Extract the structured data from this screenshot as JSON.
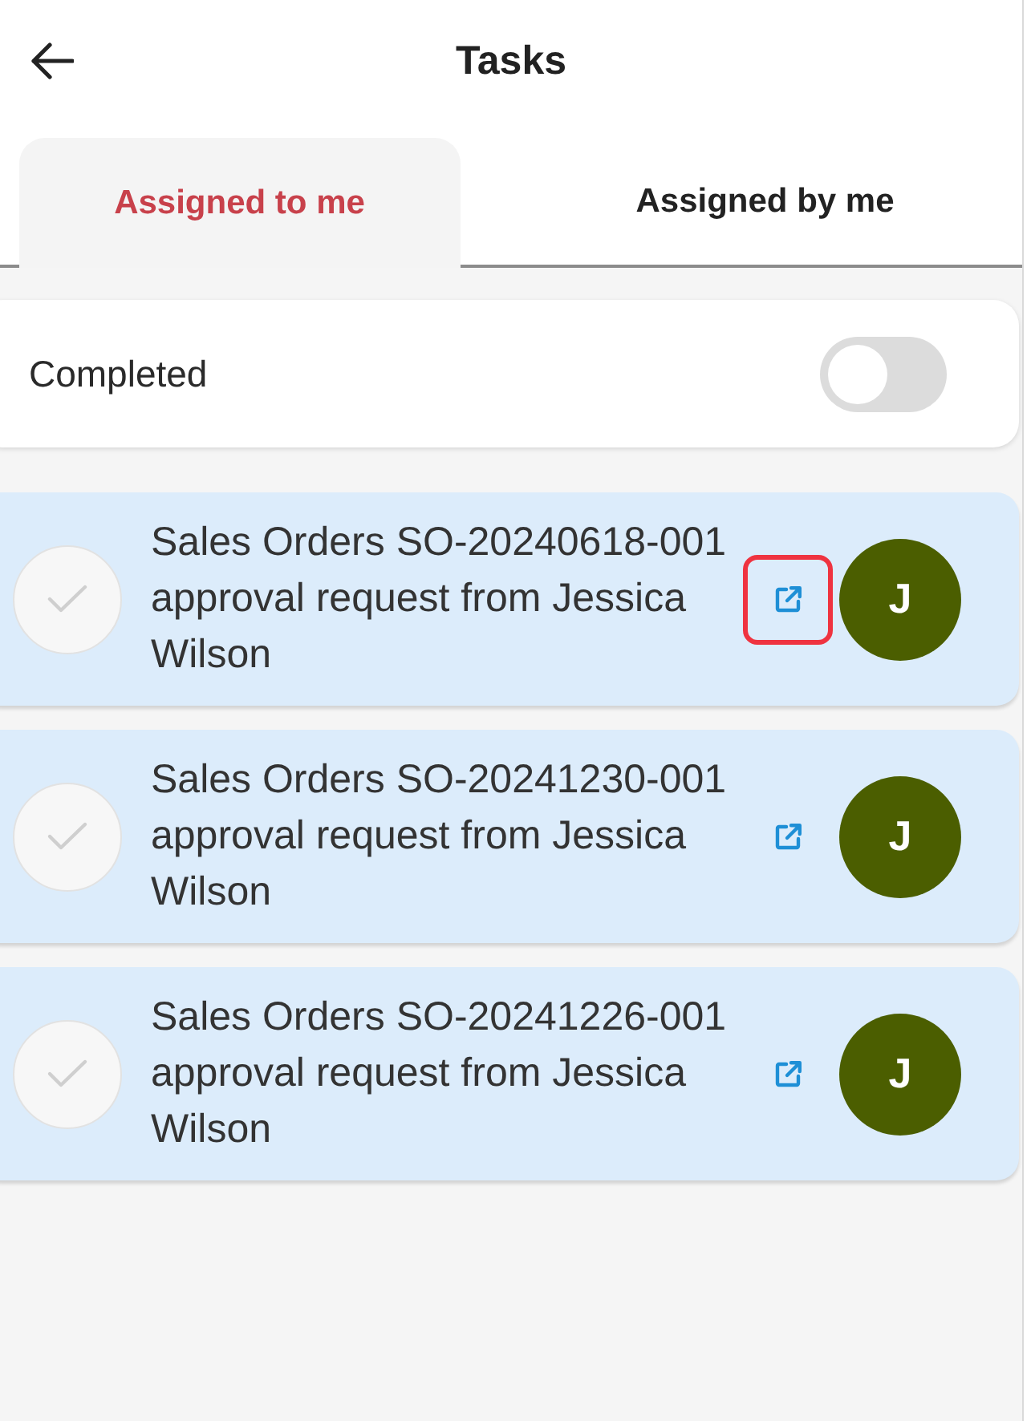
{
  "header": {
    "title": "Tasks"
  },
  "tabs": [
    {
      "label": "Assigned to me",
      "selected": true
    },
    {
      "label": "Assigned by me",
      "selected": false
    }
  ],
  "completed_filter": {
    "label": "Completed",
    "on": false
  },
  "tasks": [
    {
      "title": "Sales Orders SO-20240618-001 approval request from Jessica Wilson",
      "checked": false,
      "highlighted": true,
      "avatar_initial": "J"
    },
    {
      "title": "Sales Orders SO-20241230-001 approval request from Jessica Wilson",
      "checked": false,
      "highlighted": false,
      "avatar_initial": "J"
    },
    {
      "title": "Sales Orders SO-20241226-001 approval request from Jessica Wilson",
      "checked": false,
      "highlighted": false,
      "avatar_initial": "J"
    }
  ]
}
